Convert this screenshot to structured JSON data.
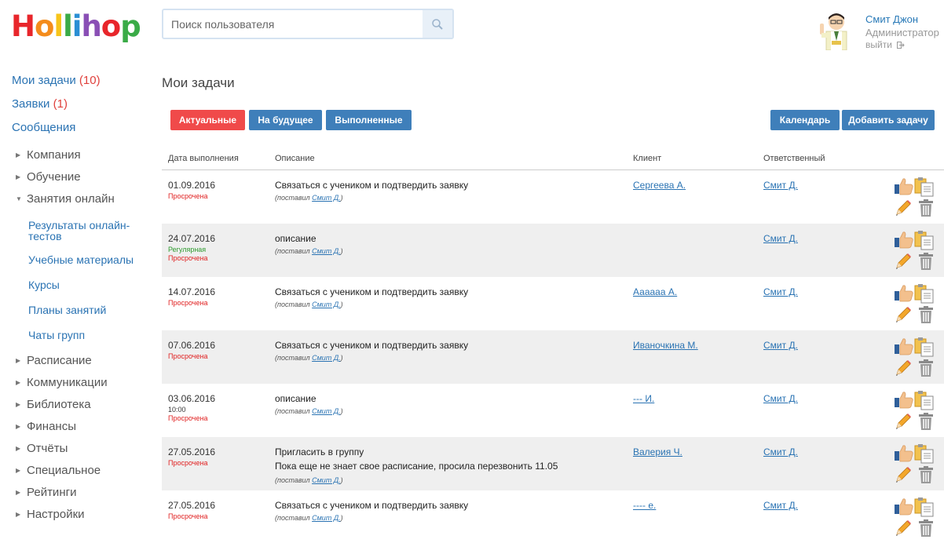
{
  "header": {
    "logo_letters": [
      {
        "ch": "H",
        "color": "#e8262b"
      },
      {
        "ch": "o",
        "color": "#f48c1c"
      },
      {
        "ch": "l",
        "color": "#f7c41a"
      },
      {
        "ch": "l",
        "color": "#3aab47"
      },
      {
        "ch": "i",
        "color": "#2b8fd4"
      },
      {
        "ch": "h",
        "color": "#8a4fb5"
      },
      {
        "ch": "o",
        "color": "#e8262b"
      },
      {
        "ch": "p",
        "color": "#3aab47"
      }
    ],
    "search_placeholder": "Поиск пользователя",
    "user_name": "Смит Джон",
    "user_role": "Администратор",
    "logout_label": "выйти"
  },
  "sidebar": {
    "top": [
      {
        "label": "Мои задачи",
        "count": "(10)"
      },
      {
        "label": "Заявки",
        "count": "(1)"
      },
      {
        "label": "Сообщения",
        "count": ""
      }
    ],
    "sections_before": [
      "Компания",
      "Обучение"
    ],
    "open_section": "Занятия онлайн",
    "sub_items": [
      "Результаты онлайн-тестов",
      "Учебные материалы",
      "Курсы",
      "Планы занятий",
      "Чаты групп"
    ],
    "sections_after": [
      "Расписание",
      "Коммуникации",
      "Библиотека",
      "Финансы",
      "Отчёты",
      "Специальное",
      "Рейтинги",
      "Настройки"
    ]
  },
  "main": {
    "title": "Мои задачи",
    "filters": [
      "Актуальные",
      "На будущее",
      "Выполненные"
    ],
    "calendar_label": "Календарь",
    "add_task_label": "Добавить задачу",
    "columns": {
      "date": "Дата выполнения",
      "desc": "Описание",
      "client": "Клиент",
      "resp": "Ответственный"
    },
    "by_prefix": "(поставил ",
    "by_suffix": ")",
    "rows": [
      {
        "date": "01.09.2016",
        "statuses": [
          {
            "text": "Просрочена",
            "kind": "red"
          }
        ],
        "desc": [
          "Связаться с учеником и подтвердить заявку"
        ],
        "by": "Смит Д.",
        "client": "Сергеева А.",
        "resp": "Смит Д."
      },
      {
        "date": "24.07.2016",
        "statuses": [
          {
            "text": "Регулярная",
            "kind": "green"
          },
          {
            "text": "Просрочена",
            "kind": "red"
          }
        ],
        "desc": [
          "описание"
        ],
        "by": "Смит Д.",
        "client": "",
        "resp": "Смит Д."
      },
      {
        "date": "14.07.2016",
        "statuses": [
          {
            "text": "Просрочена",
            "kind": "red"
          }
        ],
        "desc": [
          "Связаться с учеником и подтвердить заявку"
        ],
        "by": "Смит Д.",
        "client": "Аааааа А.",
        "resp": "Смит Д."
      },
      {
        "date": "07.06.2016",
        "statuses": [
          {
            "text": "Просрочена",
            "kind": "red"
          }
        ],
        "desc": [
          "Связаться с учеником и подтвердить заявку"
        ],
        "by": "Смит Д.",
        "client": "Иваночкина М.",
        "resp": "Смит Д."
      },
      {
        "date": "03.06.2016",
        "statuses": [
          {
            "text": "10:00",
            "kind": "dark"
          },
          {
            "text": "Просрочена",
            "kind": "red"
          }
        ],
        "desc": [
          "описание"
        ],
        "by": "Смит Д.",
        "client": "--- И.",
        "resp": "Смит Д."
      },
      {
        "date": "27.05.2016",
        "statuses": [
          {
            "text": "Просрочена",
            "kind": "red"
          }
        ],
        "desc": [
          "Пригласить в группу",
          "Пока еще не знает свое расписание, просила перезвонить 11.05"
        ],
        "by": "Смит Д.",
        "client": "Валерия Ч.",
        "resp": "Смит Д."
      },
      {
        "date": "27.05.2016",
        "statuses": [
          {
            "text": "Просрочена",
            "kind": "red"
          }
        ],
        "desc": [
          "Связаться с учеником и подтвердить заявку"
        ],
        "by": "Смит Д.",
        "client": "---- е.",
        "resp": "Смит Д."
      }
    ]
  },
  "icons": {
    "search": "search-icon",
    "logout": "logout-icon",
    "actions": [
      "thumbs-up-icon",
      "clipboard-copy-icon",
      "pencil-icon",
      "trash-icon"
    ]
  }
}
